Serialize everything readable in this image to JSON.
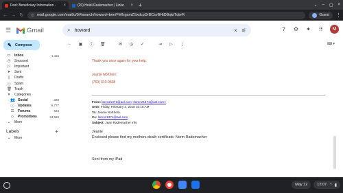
{
  "browser": {
    "tabs": [
      {
        "title": "Fwd: Beneficiary Information -",
        "favicon_color": "#d93025"
      },
      {
        "title": "(20) Heidi Rademacher | Linke",
        "favicon_color": "#0a66c2"
      }
    ],
    "url": "mail.google.com/mail/u/0/#search/howard+ben/FMfcgxmZSxdcpDrBCsvBHtDBqktTqbrR",
    "guest_label": "Guest"
  },
  "gmail": {
    "logo_text": "Gmail",
    "search_value": "howard",
    "avatar_letter": "M",
    "compose_label": "Compose",
    "nav": [
      {
        "label": "Inbox",
        "count": "1,116",
        "icon": "inbox-icon",
        "glyph": "▭",
        "bold": true
      },
      {
        "label": "Snoozed",
        "count": "",
        "icon": "clock-icon",
        "glyph": "◷",
        "bold": false
      },
      {
        "label": "Important",
        "count": "",
        "icon": "label-important-icon",
        "glyph": "▷",
        "bold": false
      },
      {
        "label": "Sent",
        "count": "",
        "icon": "send-icon",
        "glyph": "➤",
        "bold": false
      },
      {
        "label": "Drafts",
        "count": "",
        "icon": "draft-icon",
        "glyph": "▯",
        "bold": false
      },
      {
        "label": "Spam",
        "count": "",
        "icon": "spam-icon",
        "glyph": "ⓘ",
        "bold": false
      },
      {
        "label": "Trash",
        "count": "",
        "icon": "trash-icon",
        "glyph": "🗑",
        "bold": false
      },
      {
        "label": "Categories",
        "count": "",
        "icon": "categories-icon",
        "glyph": "▾",
        "bold": false
      }
    ],
    "categories": [
      {
        "label": "Social",
        "count": "328",
        "icon": "social-icon",
        "glyph": "👥"
      },
      {
        "label": "Updates",
        "count": "6,777",
        "icon": "updates-icon",
        "glyph": "ⓘ"
      },
      {
        "label": "Forums",
        "count": "534",
        "icon": "forums-icon",
        "glyph": "☰"
      },
      {
        "label": "Promotions",
        "count": "34,583",
        "icon": "promotions-icon",
        "glyph": "◇"
      }
    ],
    "more_label": "More",
    "labels_heading": "Labels",
    "labels_more": "More"
  },
  "email": {
    "thanks": "Thank you once again for your help.",
    "sig_name": "Jeanie Northern",
    "sig_phone": "(760) 310-0608",
    "from_label": "From:",
    "from_addr": "lorenz1371@aol.com",
    "from_addr_bracket": "<lorenz1371@aol.com>",
    "sent_label": "Sent:",
    "sent_value": "Friday, February 2, 2018 10:18 AM",
    "to_label": "To:",
    "to_value": "Jeanie Northern",
    "cc_label": "Cc:",
    "cc_value": "lorenz1371@aol.com",
    "subject_label": "Subject:",
    "subject_value": "Jean Rademacher info",
    "greeting": "Jeanie",
    "body_line": "Enclosed please find my mothers death certificate. Norm Rademacher",
    "footer": "Sent from my iPad"
  },
  "shelf": {
    "date": "May 12",
    "time": "12:07",
    "app_colors": [
      "#34a853",
      "#4285f4",
      "#a142f4",
      "#1a73e8"
    ]
  }
}
